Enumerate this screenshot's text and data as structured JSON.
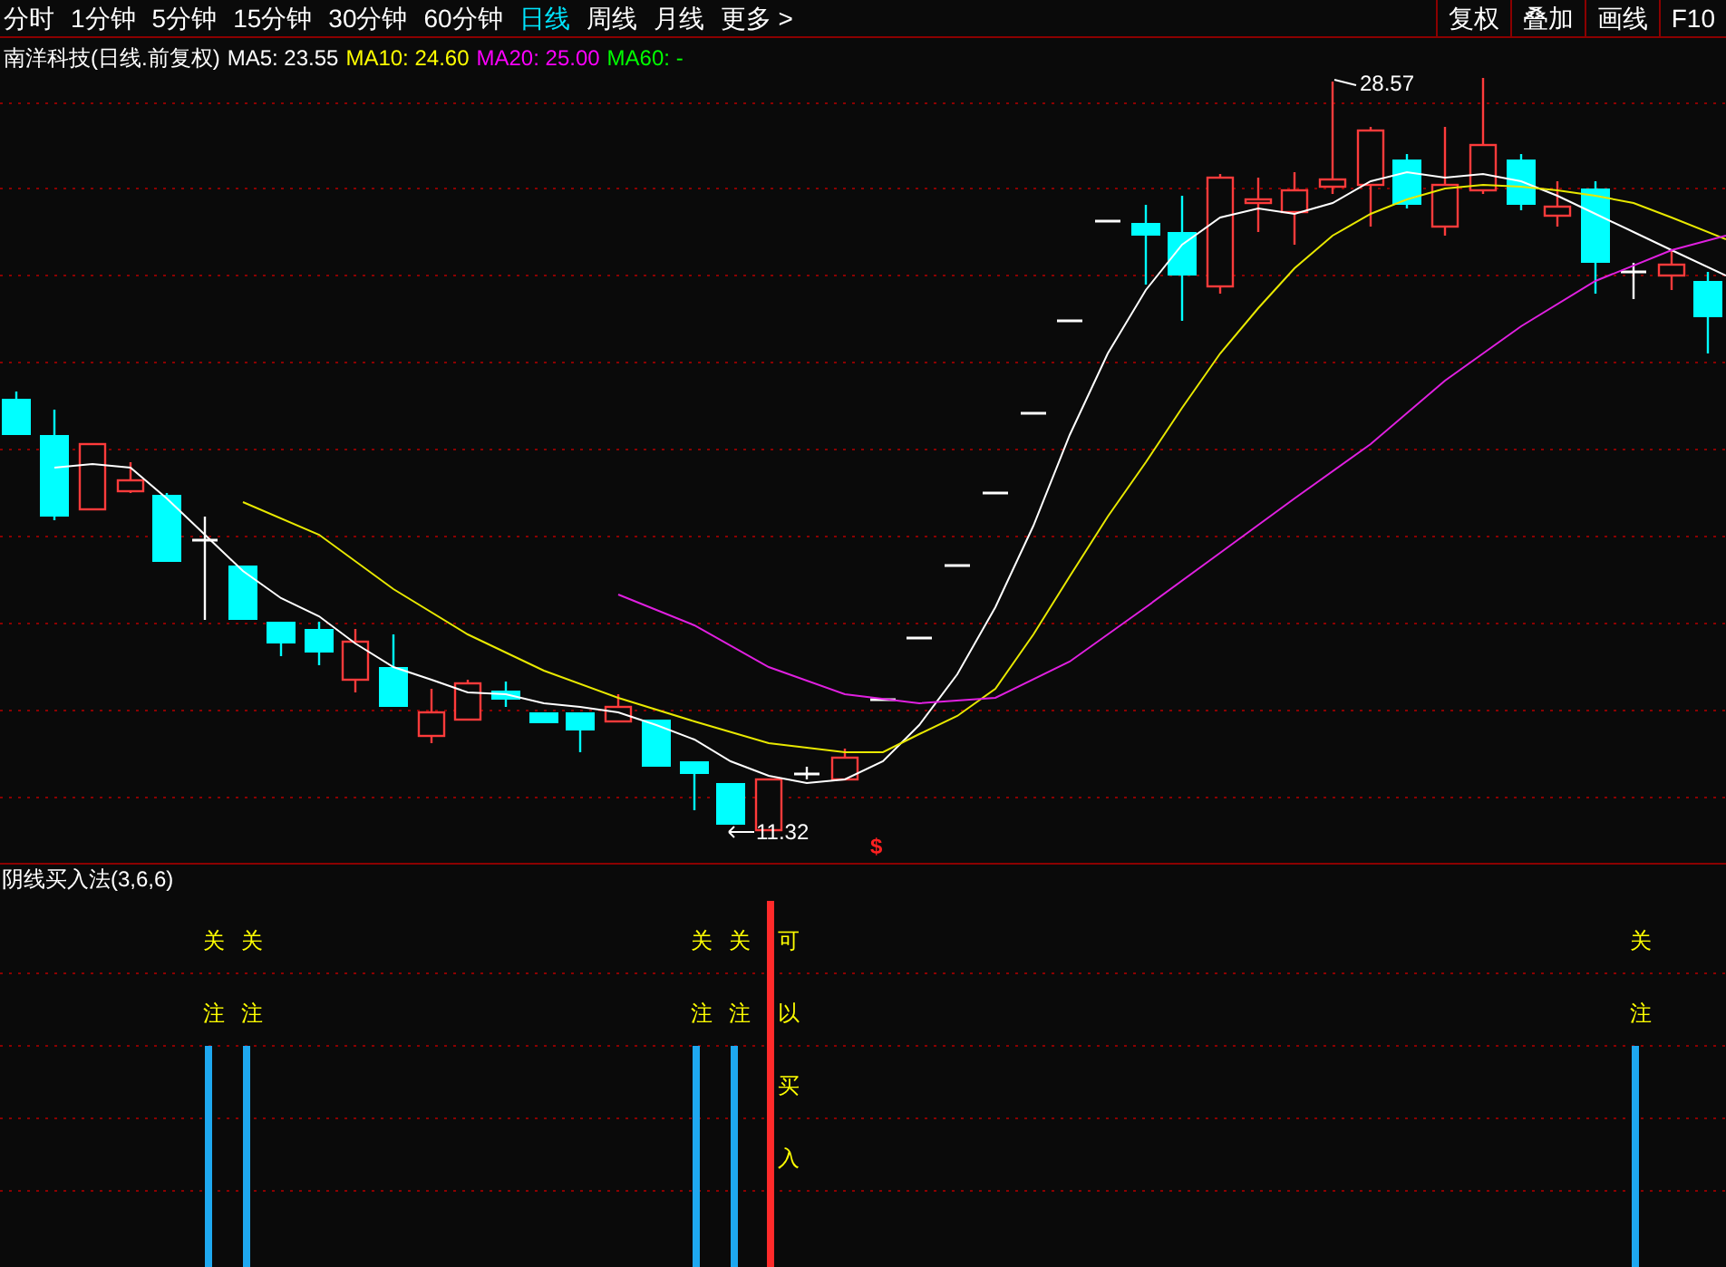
{
  "toolbar": {
    "tabs": [
      {
        "label": "分时",
        "selected": false
      },
      {
        "label": "1分钟",
        "selected": false
      },
      {
        "label": "5分钟",
        "selected": false
      },
      {
        "label": "15分钟",
        "selected": false
      },
      {
        "label": "30分钟",
        "selected": false
      },
      {
        "label": "60分钟",
        "selected": false
      },
      {
        "label": "日线",
        "selected": true
      },
      {
        "label": "周线",
        "selected": false
      },
      {
        "label": "月线",
        "selected": false
      },
      {
        "label": "更多 >",
        "selected": false
      }
    ],
    "buttons": [
      "复权",
      "叠加",
      "画线",
      "F10"
    ]
  },
  "legend": {
    "title": "南洋科技(日线.前复权)",
    "averages": [
      {
        "label": "MA5: 23.55",
        "color": "#ffffff"
      },
      {
        "label": "MA10: 24.60",
        "color": "#ffff00"
      },
      {
        "label": "MA20: 25.00",
        "color": "#ff00ff"
      },
      {
        "label": "MA60: -",
        "color": "#00ff00"
      }
    ]
  },
  "price_chart": {
    "high_label": "28.57",
    "low_label": "11.32",
    "signal_marker": "$"
  },
  "indicator": {
    "title": "阴线买入法(3,6,6)",
    "signals": [
      {
        "kind": "watch",
        "text": "关注"
      },
      {
        "kind": "watch",
        "text": "关注"
      },
      {
        "kind": "watch",
        "text": "关注"
      },
      {
        "kind": "watch",
        "text": "关注"
      },
      {
        "kind": "buy",
        "text": "可以买入"
      },
      {
        "kind": "watch",
        "text": "关注"
      }
    ]
  }
}
